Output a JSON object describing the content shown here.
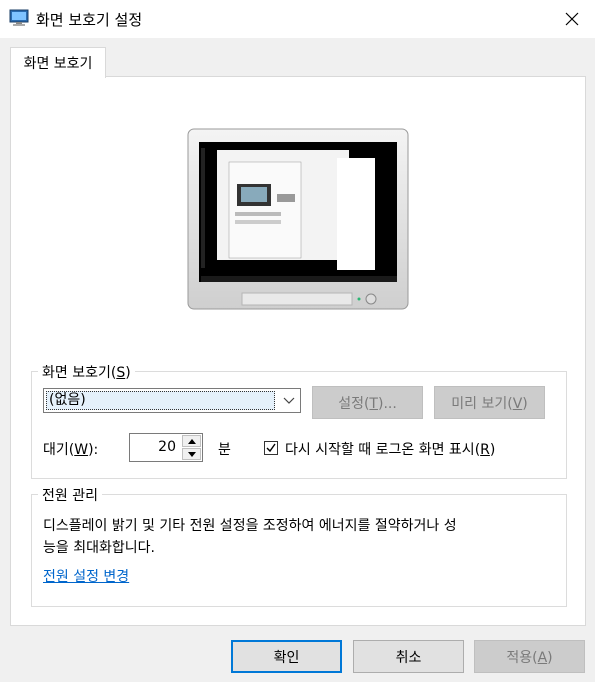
{
  "window": {
    "title": "화면 보호기 설정",
    "close_icon": "close-icon"
  },
  "tab": {
    "label": "화면 보호기"
  },
  "screensaver": {
    "group_label": "화면 보호기(S)",
    "selected": "(없음)",
    "settings_button": "설정(T)...",
    "preview_button": "미리 보기(V)",
    "wait_label": "대기(W):",
    "wait_value": "20",
    "minutes_label": "분",
    "resume_checked": true,
    "resume_label": "다시 시작할 때 로그온 화면 표시(R)"
  },
  "power": {
    "group_label": "전원 관리",
    "description_line1": "디스플레이 밝기 및 기타 전원 설정을 조정하여 에너지를 절약하거나 성",
    "description_line2": "능을 최대화합니다.",
    "link_label": "전원 설정 변경"
  },
  "footer": {
    "ok": "확인",
    "cancel": "취소",
    "apply": "적용(A)"
  },
  "colors": {
    "link": "#0066cc",
    "accent": "#0078d7",
    "disabled_bg": "#cccccc"
  }
}
